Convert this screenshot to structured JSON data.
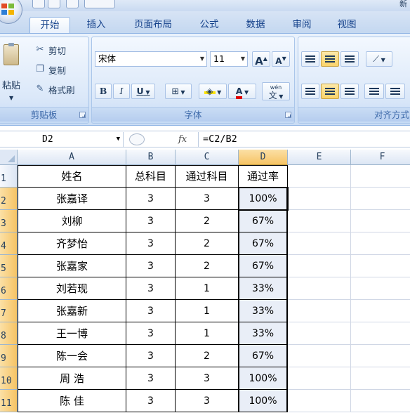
{
  "title": {
    "text": "新"
  },
  "tabs": [
    {
      "label": "开始",
      "active": true
    },
    {
      "label": "插入",
      "active": false
    },
    {
      "label": "页面布局",
      "active": false
    },
    {
      "label": "公式",
      "active": false
    },
    {
      "label": "数据",
      "active": false
    },
    {
      "label": "审阅",
      "active": false
    },
    {
      "label": "视图",
      "active": false
    }
  ],
  "clipboard": {
    "paste_label": "粘贴",
    "cut_label": "剪切",
    "copy_label": "复制",
    "format_painter_label": "格式刷",
    "group_label": "剪贴板"
  },
  "font": {
    "font_name": "宋体",
    "font_size": "11",
    "grow_label": "A",
    "shrink_label": "A",
    "bold_label": "B",
    "italic_label": "I",
    "underline_label": "U",
    "font_color_label": "A",
    "phonetic_top": "wén",
    "phonetic_bottom": "文",
    "group_label": "字体"
  },
  "alignment": {
    "group_label": "对齐方式"
  },
  "formula_bar": {
    "name_box": "D2",
    "fx_label": "fx",
    "formula": "=C2/B2"
  },
  "sheet": {
    "columns": [
      "A",
      "B",
      "C",
      "D",
      "E",
      "F"
    ],
    "selected_column": "D",
    "header": [
      "姓名",
      "总科目",
      "通过科目",
      "通过率"
    ],
    "rows": [
      {
        "num": "1"
      },
      {
        "num": "2",
        "name": "张嘉译",
        "total": "3",
        "passed": "3",
        "rate": "100%"
      },
      {
        "num": "3",
        "name": "刘柳",
        "total": "3",
        "passed": "2",
        "rate": "67%"
      },
      {
        "num": "4",
        "name": "齐梦怡",
        "total": "3",
        "passed": "2",
        "rate": "67%"
      },
      {
        "num": "5",
        "name": "张嘉家",
        "total": "3",
        "passed": "2",
        "rate": "67%"
      },
      {
        "num": "6",
        "name": "刘若现",
        "total": "3",
        "passed": "1",
        "rate": "33%"
      },
      {
        "num": "7",
        "name": "张嘉新",
        "total": "3",
        "passed": "1",
        "rate": "33%"
      },
      {
        "num": "8",
        "name": "王一博",
        "total": "3",
        "passed": "1",
        "rate": "33%"
      },
      {
        "num": "9",
        "name": "陈一会",
        "total": "3",
        "passed": "2",
        "rate": "67%"
      },
      {
        "num": "10",
        "name": "周 浩",
        "total": "3",
        "passed": "3",
        "rate": "100%"
      },
      {
        "num": "11",
        "name": "陈 佳",
        "total": "3",
        "passed": "3",
        "rate": "100%"
      }
    ]
  },
  "colors": {
    "ribbon_blue": "#dbe8f9",
    "tab_text": "#15428b",
    "selected_header": "#f6c465",
    "selection_fill": "#e9eef7"
  }
}
